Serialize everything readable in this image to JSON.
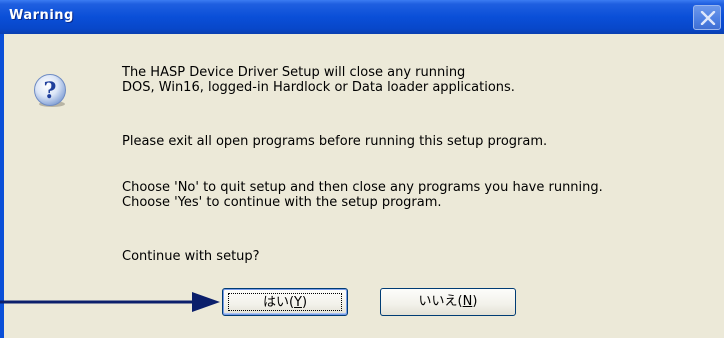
{
  "window": {
    "title": "Warning"
  },
  "icons": {
    "question": "question-icon",
    "close": "close-icon"
  },
  "message": {
    "line1": "The HASP Device Driver Setup will close any running",
    "line2": "DOS, Win16, logged-in Hardlock or Data loader applications.",
    "line3": "Please exit all open programs before running this setup program.",
    "line4": "Choose 'No' to quit setup and then close any programs you have running.",
    "line5": "Choose 'Yes' to continue with the setup program.",
    "line6": "Continue with setup?"
  },
  "buttons": {
    "yes_label": "はい(",
    "yes_accel": "Y",
    "yes_suffix": ")",
    "no_label": "いいえ(",
    "no_accel": "N",
    "no_suffix": ")"
  },
  "colors": {
    "title_bar": "#0a4fd8",
    "dialog_bg": "#ece9d8",
    "arrow": "#0b1f6b"
  }
}
